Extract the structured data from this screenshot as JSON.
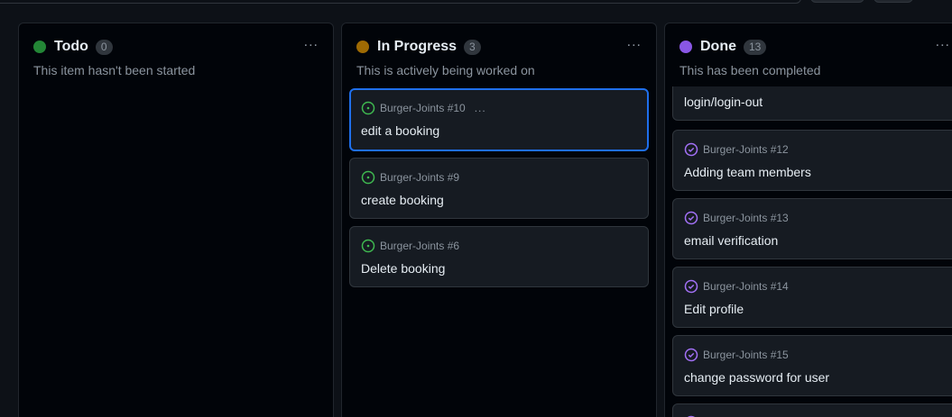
{
  "columns": [
    {
      "title": "Todo",
      "count": "0",
      "description": "This item hasn't been started",
      "color": "#238636",
      "cards": []
    },
    {
      "title": "In Progress",
      "count": "3",
      "description": "This is actively being worked on",
      "color": "#9e6a03",
      "cards": [
        {
          "ref": "Burger-Joints #10",
          "title": "edit a booking",
          "status": "open"
        },
        {
          "ref": "Burger-Joints #9",
          "title": "create booking",
          "status": "open"
        },
        {
          "ref": "Burger-Joints #6",
          "title": "Delete booking",
          "status": "open"
        }
      ]
    },
    {
      "title": "Done",
      "count": "13",
      "description": "This has been completed",
      "color": "#8957e5",
      "cards": [
        {
          "title": "login/login-out",
          "status": "closed"
        },
        {
          "ref": "Burger-Joints #12",
          "title": "Adding team members",
          "status": "closed"
        },
        {
          "ref": "Burger-Joints #13",
          "title": "email verification",
          "status": "closed"
        },
        {
          "ref": "Burger-Joints #14",
          "title": "Edit profile",
          "status": "closed"
        },
        {
          "ref": "Burger-Joints #15",
          "title": "change password for user",
          "status": "closed"
        }
      ]
    }
  ],
  "menu_icon": "..."
}
